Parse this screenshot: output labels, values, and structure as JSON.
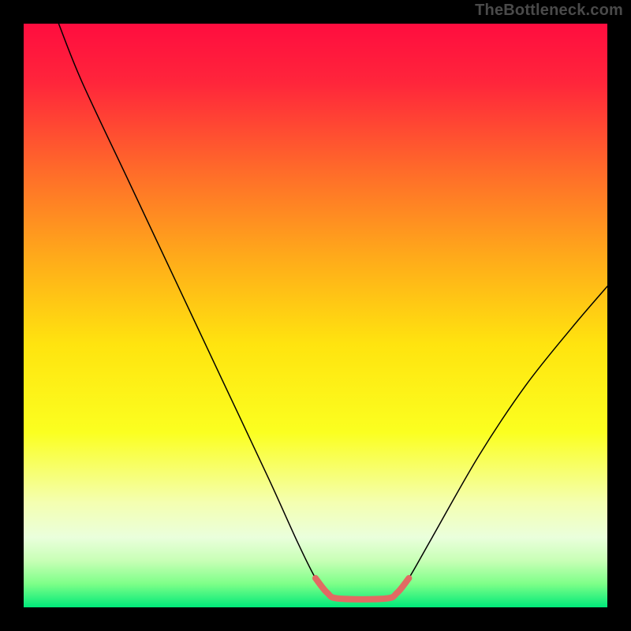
{
  "watermark": "TheBottleneck.com",
  "chart_data": {
    "type": "line",
    "title": "",
    "xlabel": "",
    "ylabel": "",
    "xlim": [
      0,
      100
    ],
    "ylim": [
      0,
      100
    ],
    "grid": false,
    "legend": false,
    "gradient_stops": [
      {
        "offset": 0,
        "color": "#ff0d3f"
      },
      {
        "offset": 10,
        "color": "#ff253b"
      },
      {
        "offset": 25,
        "color": "#ff6a2a"
      },
      {
        "offset": 40,
        "color": "#ffaa1a"
      },
      {
        "offset": 55,
        "color": "#ffe40f"
      },
      {
        "offset": 70,
        "color": "#fbff20"
      },
      {
        "offset": 82,
        "color": "#f4ffb0"
      },
      {
        "offset": 88,
        "color": "#eaffdc"
      },
      {
        "offset": 92,
        "color": "#c8ffb6"
      },
      {
        "offset": 96,
        "color": "#7dff88"
      },
      {
        "offset": 100,
        "color": "#00e97a"
      }
    ],
    "series": [
      {
        "name": "bottleneck-curve",
        "color": "#000000",
        "width": 1.5,
        "points": [
          {
            "x": 6,
            "y": 100
          },
          {
            "x": 10,
            "y": 90
          },
          {
            "x": 18,
            "y": 73
          },
          {
            "x": 26,
            "y": 56
          },
          {
            "x": 34,
            "y": 39
          },
          {
            "x": 42,
            "y": 22
          },
          {
            "x": 47,
            "y": 11
          },
          {
            "x": 50,
            "y": 5
          },
          {
            "x": 52,
            "y": 2.5
          },
          {
            "x": 54,
            "y": 1.5
          },
          {
            "x": 62,
            "y": 1.5
          },
          {
            "x": 64,
            "y": 2.5
          },
          {
            "x": 66,
            "y": 5
          },
          {
            "x": 70,
            "y": 12
          },
          {
            "x": 78,
            "y": 26
          },
          {
            "x": 86,
            "y": 38
          },
          {
            "x": 94,
            "y": 48
          },
          {
            "x": 100,
            "y": 55
          }
        ]
      },
      {
        "name": "optimal-range-marker",
        "color": "#e26a63",
        "width": 8,
        "cap": "round",
        "points": [
          {
            "x": 50,
            "y": 5
          },
          {
            "x": 52,
            "y": 2.5
          },
          {
            "x": 54,
            "y": 1.5
          },
          {
            "x": 62,
            "y": 1.5
          },
          {
            "x": 64,
            "y": 2.5
          },
          {
            "x": 66,
            "y": 5
          }
        ]
      }
    ]
  }
}
